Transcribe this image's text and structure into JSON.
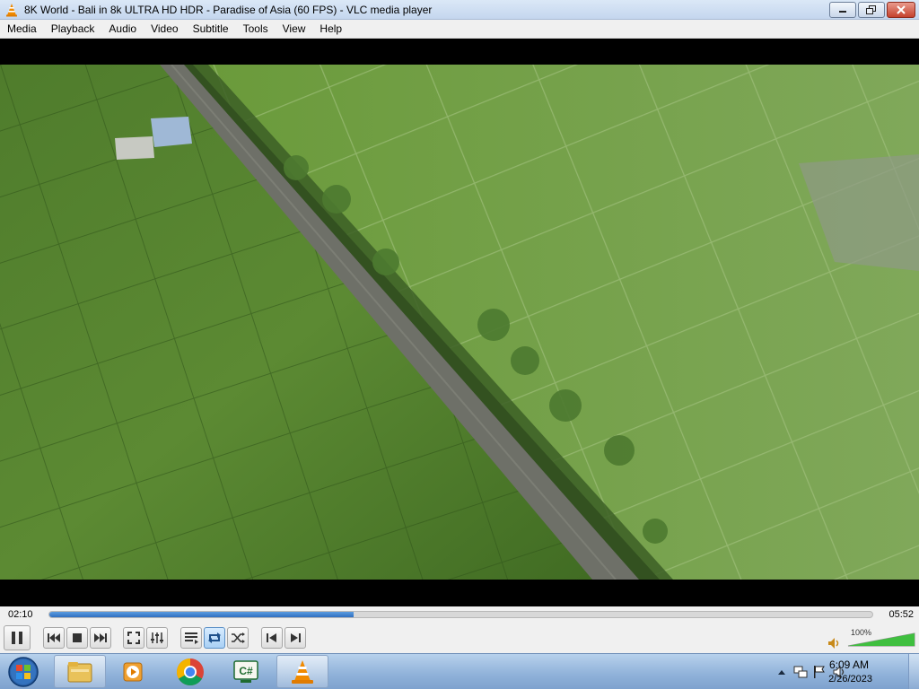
{
  "window": {
    "title": "8K World - Bali in 8k ULTRA HD HDR -  Paradise of Asia (60 FPS) - VLC media player"
  },
  "menu": [
    "Media",
    "Playback",
    "Audio",
    "Video",
    "Subtitle",
    "Tools",
    "View",
    "Help"
  ],
  "player": {
    "elapsed": "02:10",
    "total": "05:52",
    "progress": 0.37,
    "volume_label": "100%",
    "volume": 1.0
  },
  "taskbar": {
    "time": "6:09 AM",
    "date": "2/26/2023"
  },
  "colors": {
    "accent": "#3a7bd0",
    "field_dark": "#3f6a22",
    "field_light": "#6f9a3c",
    "road": "#6e7068"
  }
}
